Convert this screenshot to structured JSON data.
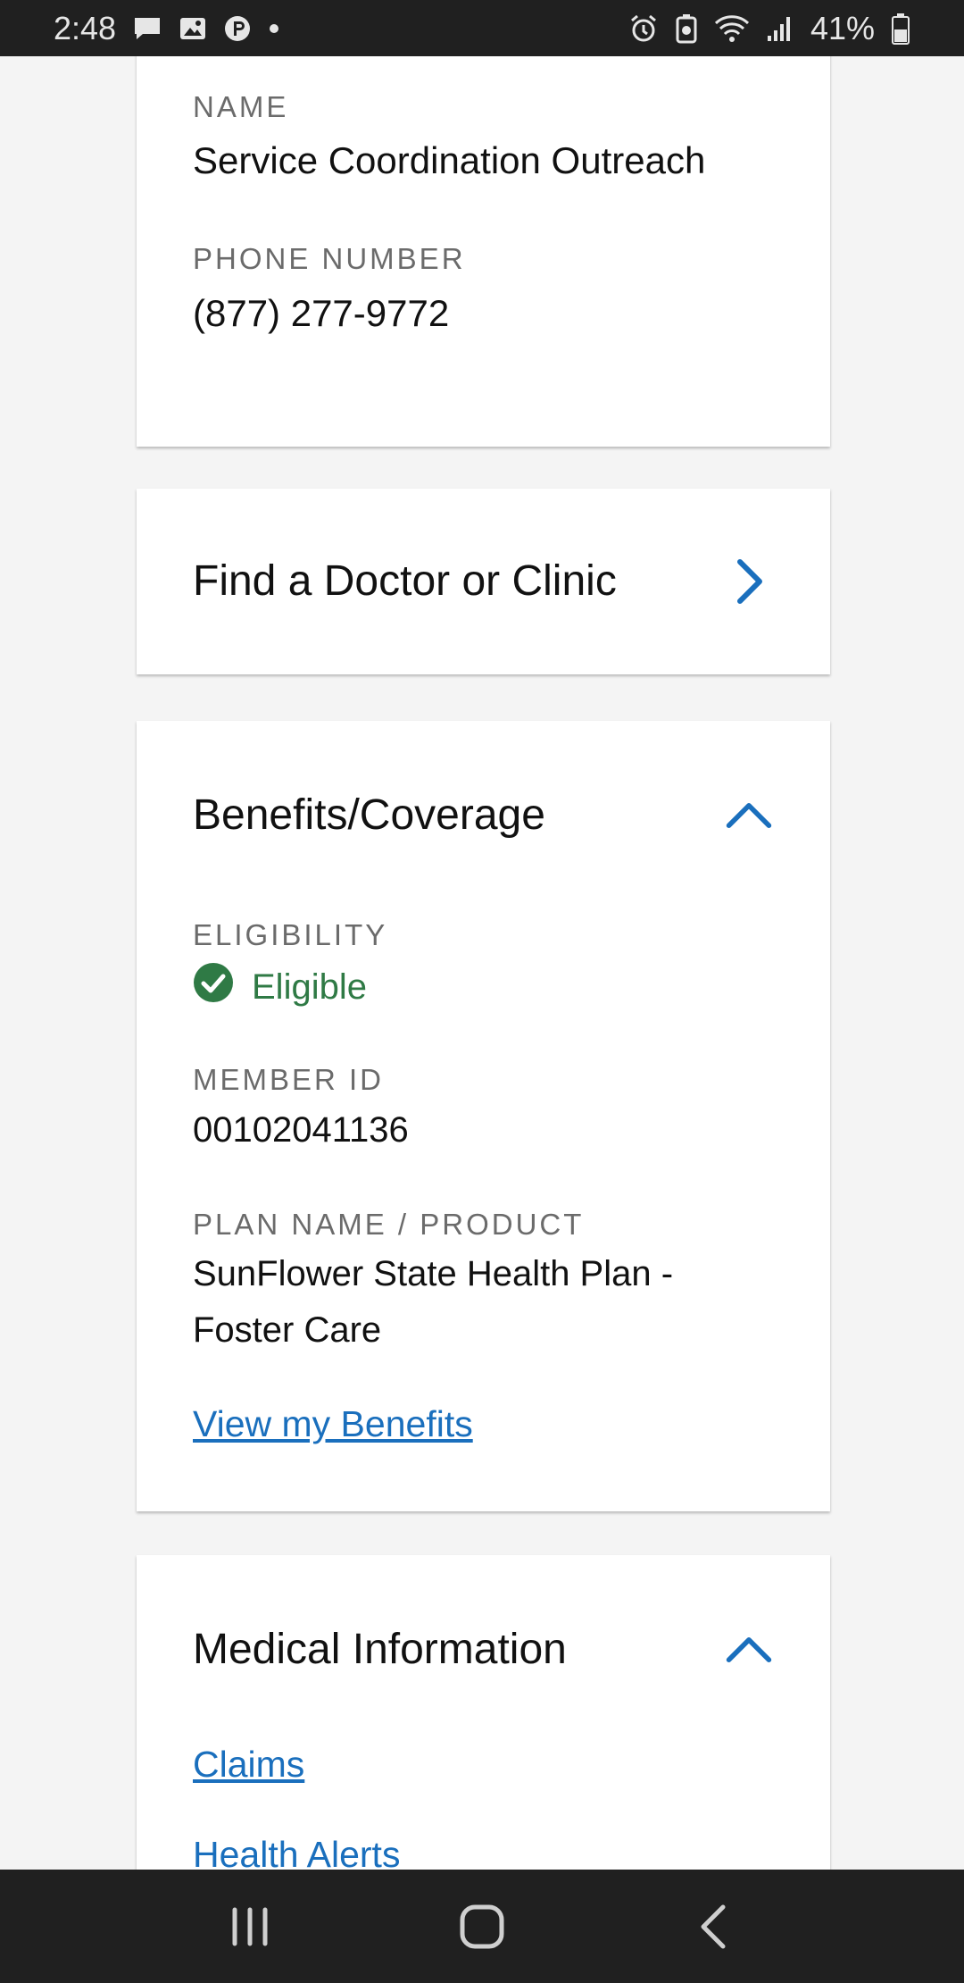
{
  "status_bar": {
    "time": "2:48",
    "battery": "41%",
    "icons_left": [
      "message-icon",
      "image-icon",
      "p-app-icon",
      "dot-icon"
    ],
    "icons_right": [
      "alarm-icon",
      "battery-saver-icon",
      "wifi-icon",
      "signal-icon",
      "battery-icon"
    ]
  },
  "contact": {
    "name_label": "NAME",
    "name_value": "Service Coordination Outreach",
    "phone_label": "PHONE NUMBER",
    "phone_value": "(877) 277-9772"
  },
  "find_doctor": {
    "title": "Find a Doctor or Clinic"
  },
  "benefits": {
    "title": "Benefits/Coverage",
    "eligibility_label": "ELIGIBILITY",
    "eligibility_value": "Eligible",
    "member_id_label": "MEMBER ID",
    "member_id_value": "00102041136",
    "plan_label": "PLAN NAME / PRODUCT",
    "plan_value_line1": "SunFlower State Health Plan -",
    "plan_value_line2": "Foster Care",
    "view_link": "View my Benefits"
  },
  "medical": {
    "title": "Medical Information",
    "links": [
      "Claims",
      "Health Alerts"
    ]
  },
  "colors": {
    "accent": "#1a6fbd",
    "eligible_green": "#2f7a45",
    "bar_bg": "#202020"
  }
}
